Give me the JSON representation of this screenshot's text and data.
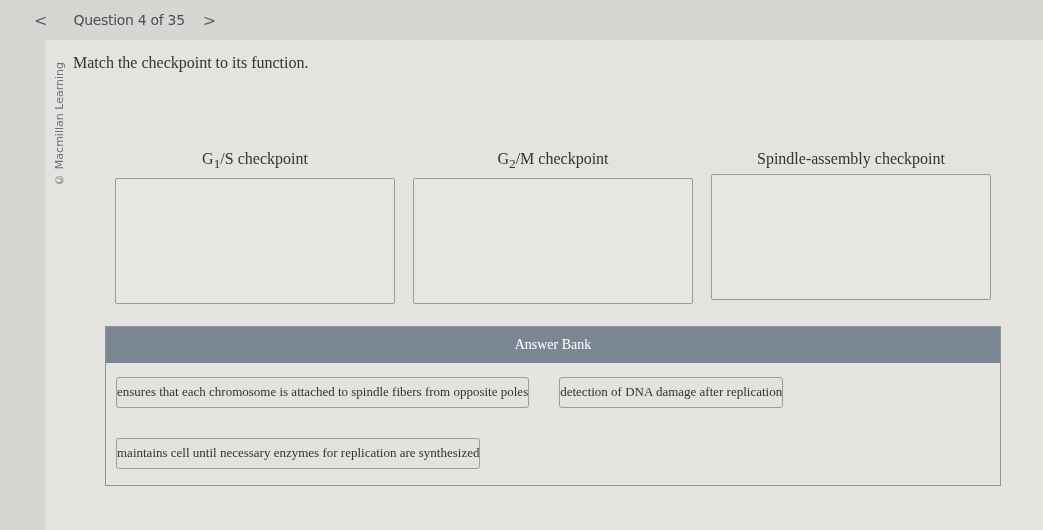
{
  "header": {
    "prev": "<",
    "title": "Question 4 of 35",
    "next": ">"
  },
  "copyright": "© Macmillan Learning",
  "prompt": "Match the checkpoint to its function.",
  "targets": [
    {
      "label": "G$_{1}$/S checkpoint"
    },
    {
      "label": "G$_{2}$/M checkpoint"
    },
    {
      "label": "Spindle-assembly checkpoint"
    }
  ],
  "answer_bank": {
    "title": "Answer Bank",
    "rows": [
      [
        "ensures that each chromosome is attached to spindle fibers from opposite poles",
        "detection of DNA damage after replication"
      ],
      [
        "maintains cell until necessary enzymes for replication are synthesized"
      ]
    ]
  }
}
